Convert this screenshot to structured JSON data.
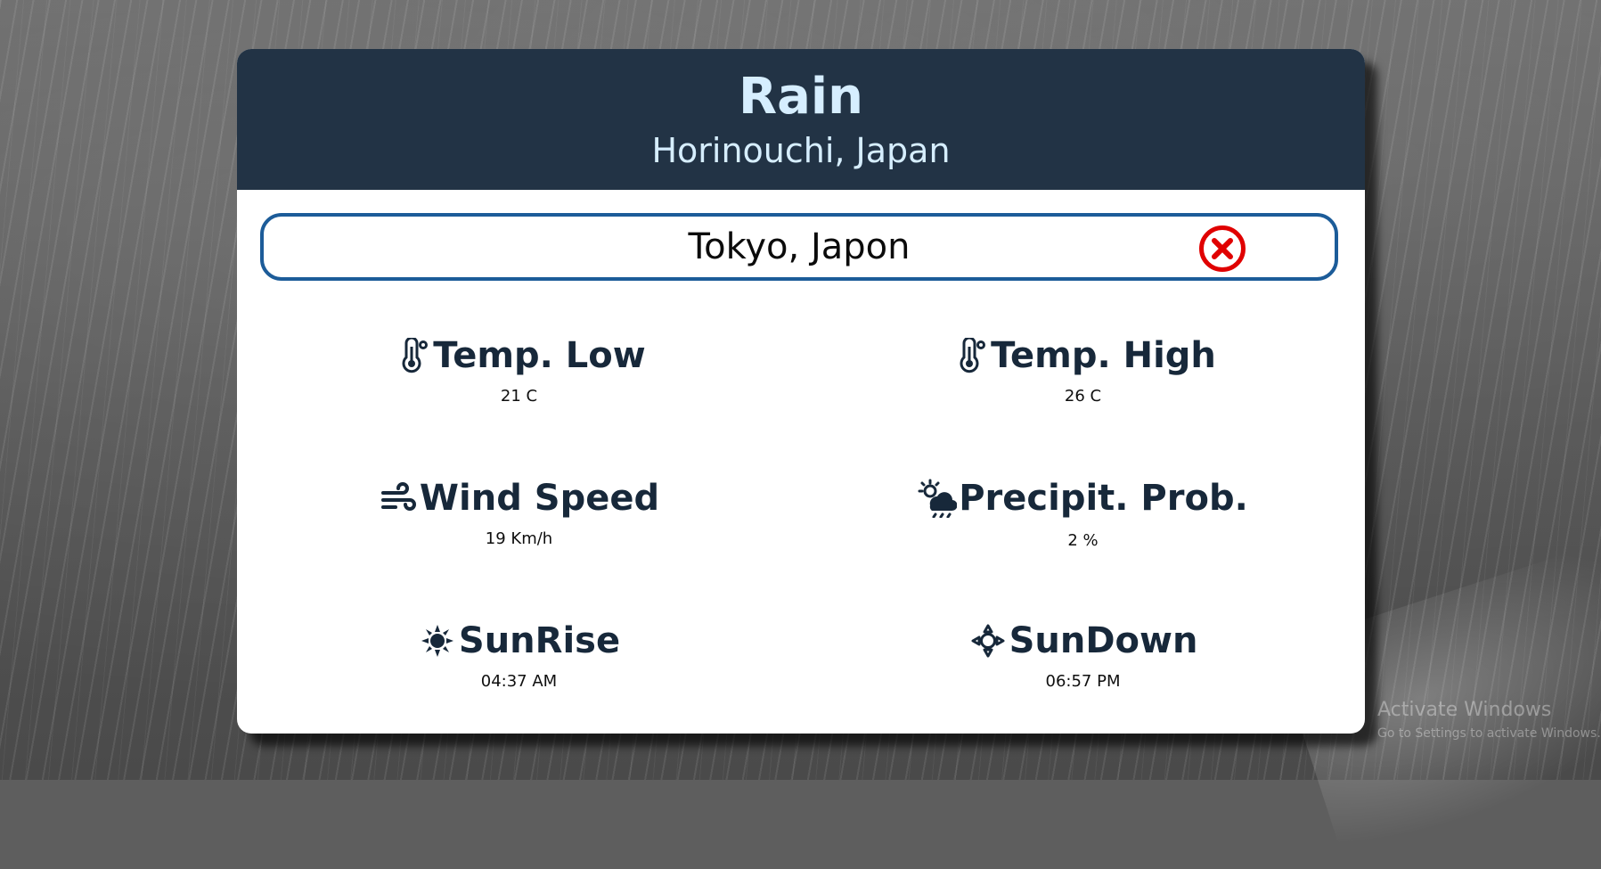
{
  "header": {
    "title": "Rain",
    "subtitle": "Horinouchi, Japan"
  },
  "search": {
    "value": "Tokyo, Japon"
  },
  "stats": [
    {
      "label": "Temp. Low",
      "value": "21 C",
      "icon": "thermometer-icon"
    },
    {
      "label": "Temp. High",
      "value": "26 C",
      "icon": "thermometer-icon"
    },
    {
      "label": "Wind Speed",
      "value": "19 Km/h",
      "icon": "wind-icon"
    },
    {
      "label": "Precipit. Prob.",
      "value": "2 %",
      "icon": "rain-sun-cloud-icon"
    },
    {
      "label": "SunRise",
      "value": "04:37 AM",
      "icon": "sun-icon"
    },
    {
      "label": "SunDown",
      "value": "06:57 PM",
      "icon": "sun-outline-icon"
    }
  ],
  "watermark": {
    "line1": "Activate Windows",
    "line2": "Go to Settings to activate Windows."
  }
}
